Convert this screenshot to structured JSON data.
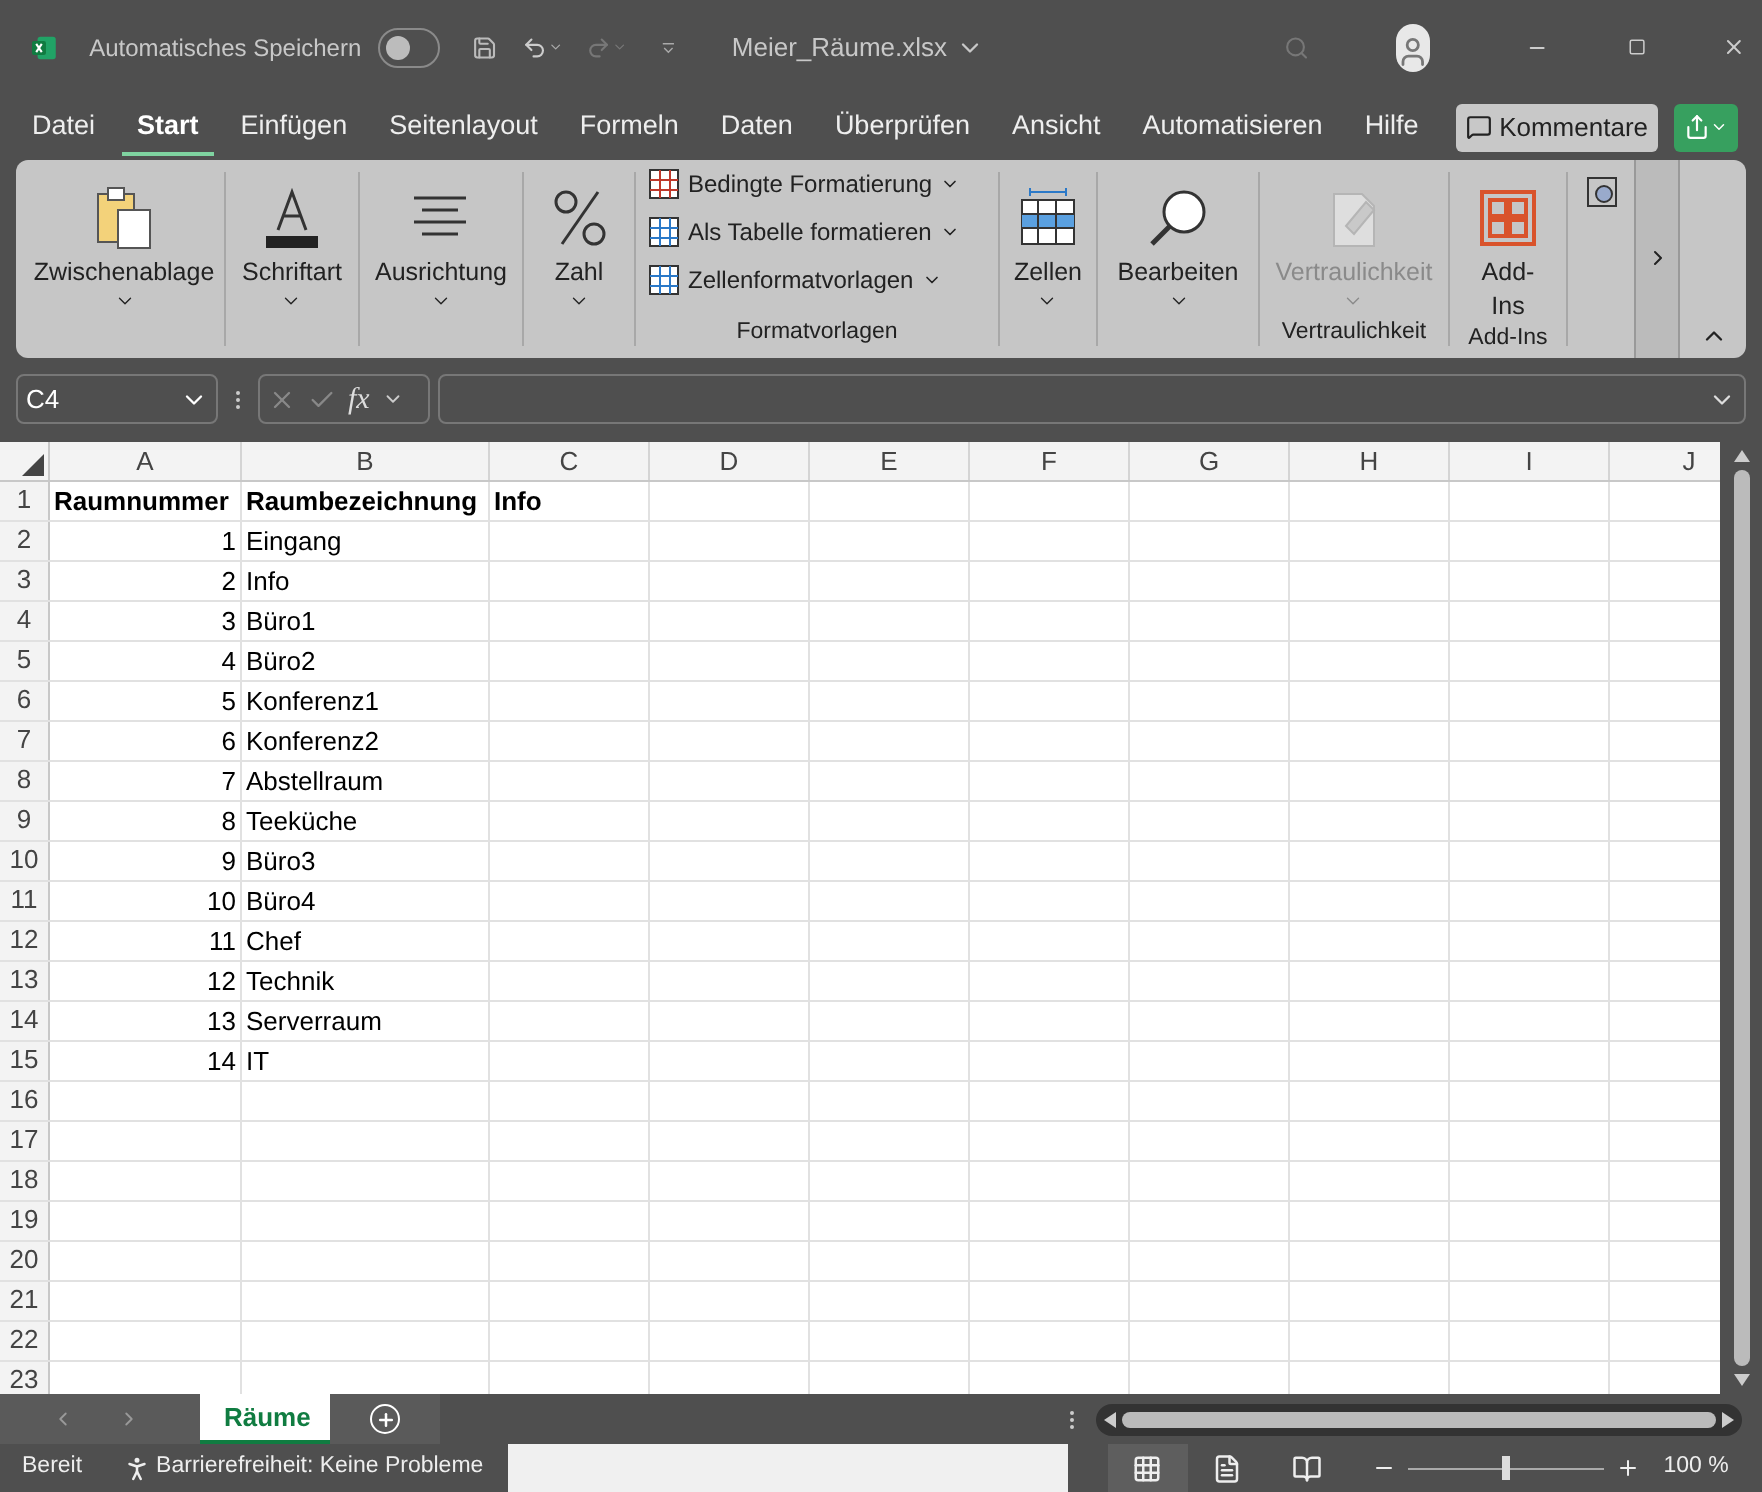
{
  "title_bar": {
    "autosave_label": "Automatisches Speichern",
    "autosave_on": false,
    "filename": "Meier_Räume.xlsx"
  },
  "menu_tabs": [
    {
      "label": "Datei",
      "selected": false
    },
    {
      "label": "Start",
      "selected": true
    },
    {
      "label": "Einfügen",
      "selected": false
    },
    {
      "label": "Seitenlayout",
      "selected": false
    },
    {
      "label": "Formeln",
      "selected": false
    },
    {
      "label": "Daten",
      "selected": false
    },
    {
      "label": "Überprüfen",
      "selected": false
    },
    {
      "label": "Ansicht",
      "selected": false
    },
    {
      "label": "Automatisieren",
      "selected": false
    },
    {
      "label": "Hilfe",
      "selected": false
    }
  ],
  "comments_button": "Kommentare",
  "ribbon": {
    "groups": [
      {
        "buttons": [
          {
            "kind": "large",
            "label": "Zwischenablage",
            "dropdown": true,
            "disabled": false
          }
        ]
      },
      {
        "buttons": [
          {
            "kind": "large",
            "label": "Schriftart",
            "dropdown": true,
            "disabled": false
          }
        ]
      },
      {
        "buttons": [
          {
            "kind": "large",
            "label": "Ausrichtung",
            "dropdown": true,
            "disabled": false
          }
        ]
      },
      {
        "buttons": [
          {
            "kind": "large",
            "label": "Zahl",
            "dropdown": true,
            "disabled": false
          }
        ]
      },
      {
        "label": "Formatvorlagen",
        "buttons": [
          {
            "kind": "small",
            "label": "Bedingte Formatierung",
            "dropdown": true,
            "disabled": false
          },
          {
            "kind": "small",
            "label": "Als Tabelle formatieren",
            "dropdown": true,
            "disabled": false
          },
          {
            "kind": "small",
            "label": "Zellenformatvorlagen",
            "dropdown": true,
            "disabled": false
          }
        ]
      },
      {
        "buttons": [
          {
            "kind": "large",
            "label": "Zellen",
            "dropdown": true,
            "disabled": false
          }
        ]
      },
      {
        "buttons": [
          {
            "kind": "large",
            "label": "Bearbeiten",
            "dropdown": true,
            "disabled": false
          }
        ]
      },
      {
        "label": "Vertraulichkeit",
        "buttons": [
          {
            "kind": "large",
            "label": "Vertraulichkeit",
            "dropdown": true,
            "disabled": true
          }
        ]
      },
      {
        "label": "Add-Ins",
        "buttons": [
          {
            "kind": "large",
            "label": "Add-Ins",
            "disabled": false
          }
        ]
      }
    ]
  },
  "formula_bar": {
    "name_box": "C4",
    "fx": "fx"
  },
  "sheet": {
    "columns": [
      "A",
      "B",
      "C",
      "D",
      "E",
      "F",
      "G",
      "H",
      "I",
      "J"
    ],
    "rows": [
      {
        "row": "1",
        "header": true,
        "a": "Raumnummer",
        "b": "Raumbezeichnung",
        "c": "Info"
      },
      {
        "row": "2",
        "a": "1",
        "b": "Eingang"
      },
      {
        "row": "3",
        "a": "2",
        "b": "Info"
      },
      {
        "row": "4",
        "a": "3",
        "b": "Büro1"
      },
      {
        "row": "5",
        "a": "4",
        "b": "Büro2"
      },
      {
        "row": "6",
        "a": "5",
        "b": "Konferenz1"
      },
      {
        "row": "7",
        "a": "6",
        "b": "Konferenz2"
      },
      {
        "row": "8",
        "a": "7",
        "b": "Abstellraum"
      },
      {
        "row": "9",
        "a": "8",
        "b": "Teeküche"
      },
      {
        "row": "10",
        "a": "9",
        "b": "Büro3"
      },
      {
        "row": "11",
        "a": "10",
        "b": "Büro4"
      },
      {
        "row": "12",
        "a": "11",
        "b": "Chef"
      },
      {
        "row": "13",
        "a": "12",
        "b": "Technik"
      },
      {
        "row": "14",
        "a": "13",
        "b": "Serverraum"
      },
      {
        "row": "15",
        "a": "14",
        "b": "IT"
      },
      {
        "row": "16"
      },
      {
        "row": "17"
      },
      {
        "row": "18"
      },
      {
        "row": "19"
      },
      {
        "row": "20"
      },
      {
        "row": "21"
      },
      {
        "row": "22"
      },
      {
        "row": "23"
      }
    ]
  },
  "sheet_tabs": [
    {
      "label": "Räume",
      "selected": true
    }
  ],
  "status_bar": {
    "ready": "Bereit",
    "accessibility": "Barrierefreiheit: Keine Probleme",
    "views": [
      {
        "selected": true
      },
      {
        "selected": false
      },
      {
        "selected": false
      }
    ],
    "zoom_slider": {
      "level": 0.5
    },
    "zoom": "100 %"
  }
}
